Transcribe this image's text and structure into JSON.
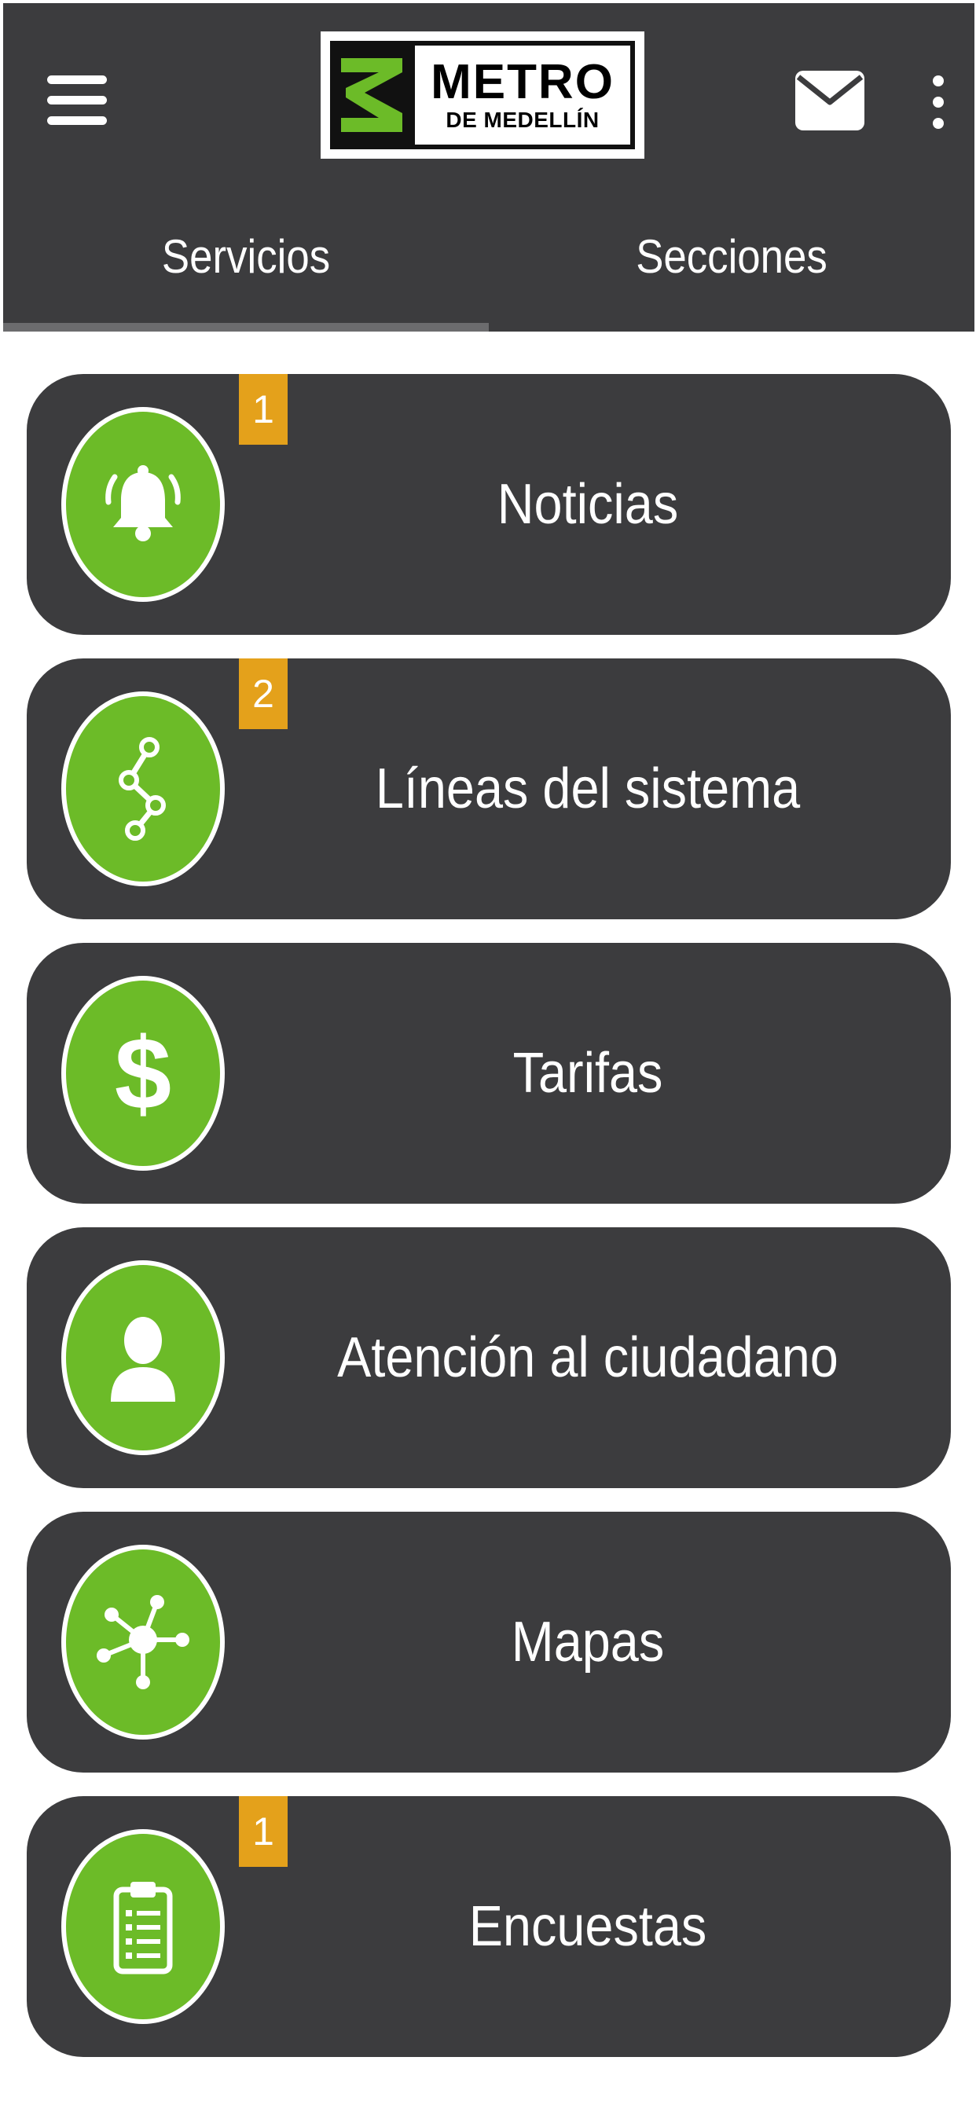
{
  "header": {
    "logo_line1": "METRO",
    "logo_line2": "DE MEDELLÍN",
    "menu_icon": "hamburger-icon",
    "mail_icon": "envelope-icon",
    "more_icon": "more-vertical-icon"
  },
  "tabs": [
    {
      "label": "Servicios",
      "selected": true
    },
    {
      "label": "Secciones",
      "selected": false
    }
  ],
  "items": [
    {
      "label": "Noticias",
      "icon": "bell-icon",
      "badge": "1"
    },
    {
      "label": "Líneas del sistema",
      "icon": "route-icon",
      "badge": "2"
    },
    {
      "label": "Tarifas",
      "icon": "dollar-icon",
      "badge": null
    },
    {
      "label": "Atención al ciudadano",
      "icon": "person-icon",
      "badge": null
    },
    {
      "label": "Mapas",
      "icon": "network-icon",
      "badge": null
    },
    {
      "label": "Encuestas",
      "icon": "clipboard-icon",
      "badge": "1"
    }
  ],
  "colors": {
    "bar": "#3c3c3e",
    "accent_green": "#6cbb28",
    "badge_orange": "#e4a11b",
    "text": "#ffffff"
  }
}
